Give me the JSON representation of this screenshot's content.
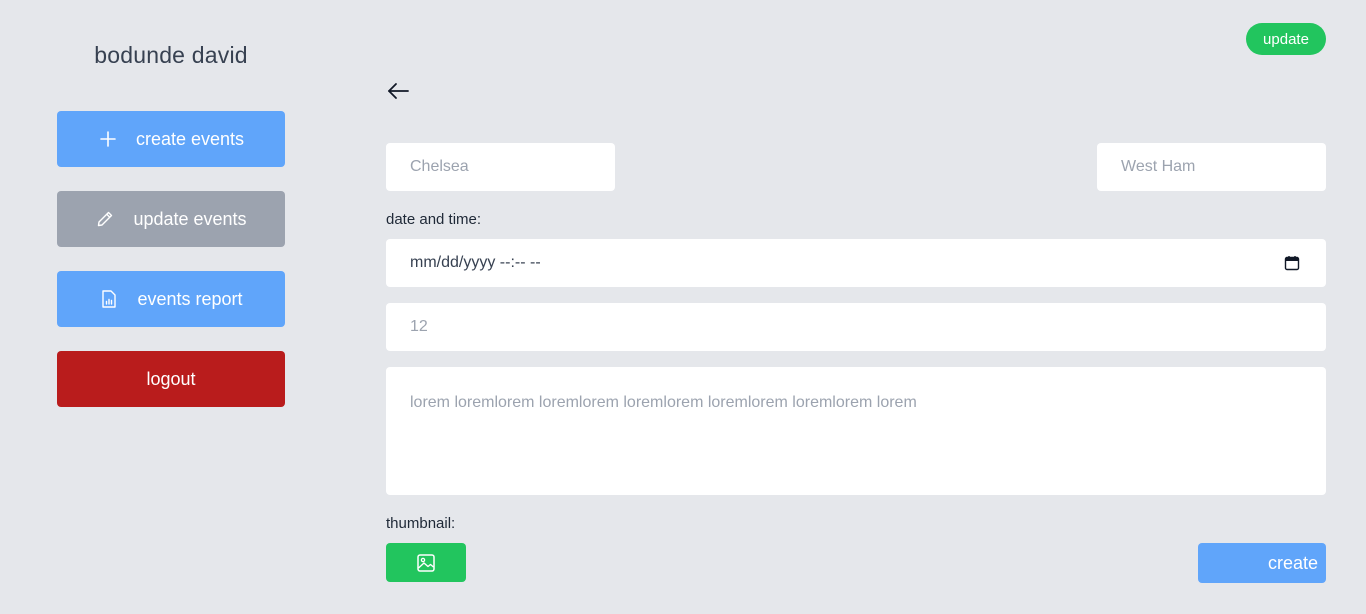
{
  "user": {
    "name": "bodunde david"
  },
  "sidebar": {
    "items": [
      {
        "label": "create events",
        "icon": "plus-icon",
        "color": "#60a5fa"
      },
      {
        "label": "update events",
        "icon": "pencil-icon",
        "color": "#9ca3af"
      },
      {
        "label": "events report",
        "icon": "report-icon",
        "color": "#60a5fa"
      },
      {
        "label": "logout",
        "icon": "",
        "color": "#b91c1c"
      }
    ]
  },
  "header": {
    "update_label": "update",
    "update_color": "#22c55e",
    "back_icon": "arrow-left-icon"
  },
  "form": {
    "home_team": {
      "placeholder": "Chelsea"
    },
    "away_team": {
      "placeholder": "West Ham"
    },
    "datetime": {
      "label": "date and time:",
      "value": "mm/dd/yyyy --:-- --",
      "icon": "calendar-icon"
    },
    "number": {
      "placeholder": "12"
    },
    "description": {
      "placeholder": "lorem loremlorem loremlorem loremlorem loremlorem loremlorem lorem"
    },
    "thumbnail": {
      "label": "thumbnail:",
      "icon": "image-icon",
      "color": "#22c55e"
    },
    "create_label": "create",
    "create_color": "#60a5fa"
  }
}
